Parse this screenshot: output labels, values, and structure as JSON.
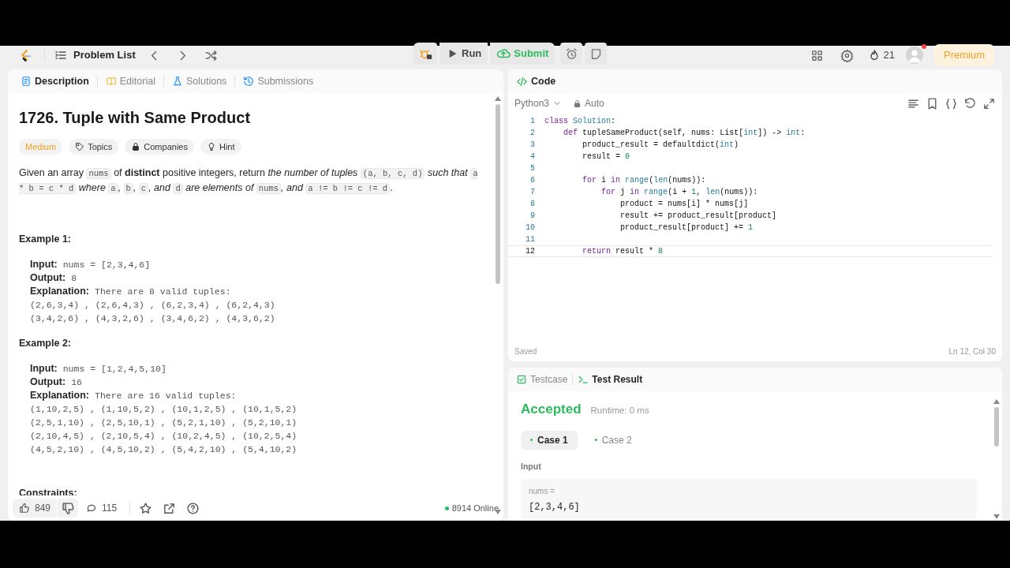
{
  "navbar": {
    "problem_list": "Problem List",
    "run": "Run",
    "submit": "Submit",
    "streak": "21",
    "premium": "Premium",
    "has_notification": true
  },
  "description_panel": {
    "tabs": [
      {
        "label": "Description",
        "selected": true
      },
      {
        "label": "Editorial",
        "selected": false
      },
      {
        "label": "Solutions",
        "selected": false
      },
      {
        "label": "Submissions",
        "selected": false
      }
    ],
    "title": "1726. Tuple with Same Product",
    "difficulty": "Medium",
    "tags": [
      {
        "label": "Topics"
      },
      {
        "label": "Companies"
      },
      {
        "label": "Hint"
      }
    ],
    "statement": [
      {
        "kind": "text",
        "t": "Given an array "
      },
      {
        "kind": "code",
        "t": "nums"
      },
      {
        "kind": "text",
        "t": " of "
      },
      {
        "kind": "bold",
        "t": "distinct"
      },
      {
        "kind": "text",
        "t": " positive integers, return "
      },
      {
        "kind": "italic",
        "t": "the number of tuples "
      },
      {
        "kind": "code",
        "t": "(a, b, c, d)"
      },
      {
        "kind": "italic",
        "t": " such that "
      },
      {
        "kind": "code",
        "t": "a * b = c * d"
      },
      {
        "kind": "italic",
        "t": " where "
      },
      {
        "kind": "code",
        "t": "a"
      },
      {
        "kind": "italic",
        "t": ", "
      },
      {
        "kind": "code",
        "t": "b"
      },
      {
        "kind": "italic",
        "t": ", "
      },
      {
        "kind": "code",
        "t": "c"
      },
      {
        "kind": "italic",
        "t": ", and "
      },
      {
        "kind": "code",
        "t": "d"
      },
      {
        "kind": "italic",
        "t": " are elements of "
      },
      {
        "kind": "code",
        "t": "nums"
      },
      {
        "kind": "italic",
        "t": ", and "
      },
      {
        "kind": "code",
        "t": "a != b != c != d"
      },
      {
        "kind": "text",
        "t": "."
      }
    ],
    "examples": [
      {
        "heading": "Example 1:",
        "lines": [
          {
            "label": "Input:",
            "value": "nums = [2,3,4,6]"
          },
          {
            "label": "Output:",
            "value": "8"
          },
          {
            "label": "Explanation:",
            "value": "There are 8 valid tuples:"
          },
          {
            "value": "(2,6,3,4) , (2,6,4,3) , (6,2,3,4) , (6,2,4,3)"
          },
          {
            "value": "(3,4,2,6) , (4,3,2,6) , (3,4,6,2) , (4,3,6,2)"
          }
        ]
      },
      {
        "heading": "Example 2:",
        "lines": [
          {
            "label": "Input:",
            "value": "nums = [1,2,4,5,10]"
          },
          {
            "label": "Output:",
            "value": "16"
          },
          {
            "label": "Explanation:",
            "value": "There are 16 valid tuples:"
          },
          {
            "value": "(1,10,2,5) , (1,10,5,2) , (10,1,2,5) , (10,1,5,2)"
          },
          {
            "value": "(2,5,1,10) , (2,5,10,1) , (5,2,1,10) , (5,2,10,1)"
          },
          {
            "value": "(2,10,4,5) , (2,10,5,4) , (10,2,4,5) , (10,2,5,4)"
          },
          {
            "value": "(4,5,2,10) , (4,5,10,2) , (5,4,2,10) , (5,4,10,2)"
          }
        ]
      }
    ],
    "constraints_heading": "Constraints:",
    "likes": "849",
    "comments": "115",
    "online": "8914 Online"
  },
  "code_panel": {
    "title": "Code",
    "language": "Python3",
    "mode": "Auto",
    "lines": [
      {
        "number": "1",
        "text": "class Solution:",
        "current": false
      },
      {
        "number": "2",
        "text": "    def tupleSameProduct(self, nums: List[int]) -> int:",
        "current": false
      },
      {
        "number": "3",
        "text": "        product_result = defaultdict(int)",
        "current": false
      },
      {
        "number": "4",
        "text": "        result = 0",
        "current": false
      },
      {
        "number": "5",
        "current": false
      },
      {
        "number": "6",
        "text": "        for i in range(len(nums)):",
        "current": false
      },
      {
        "number": "7",
        "text": "            for j in range(i + 1, len(nums)):",
        "current": false
      },
      {
        "number": "8",
        "text": "                product = nums[i] * nums[j]",
        "current": false
      },
      {
        "number": "9",
        "text": "                result += product_result[product]",
        "current": false
      },
      {
        "number": "10",
        "text": "                product_result[product] += 1",
        "current": false
      },
      {
        "number": "11",
        "current": false
      },
      {
        "number": "12",
        "text": "        return result * 8",
        "current": true
      }
    ],
    "saved": "Saved",
    "cursor_position": "Ln 12, Col 30"
  },
  "result_panel": {
    "tabs": [
      {
        "label": "Testcase",
        "selected": false
      },
      {
        "label": "Test Result",
        "selected": true
      }
    ],
    "status": "Accepted",
    "runtime": "Runtime: 0 ms",
    "cases": [
      {
        "label": "Case 1",
        "selected": true
      },
      {
        "label": "Case 2",
        "selected": false
      }
    ],
    "input_heading": "Input",
    "param_name": "nums =",
    "param_value": "[2,3,4,6]"
  }
}
